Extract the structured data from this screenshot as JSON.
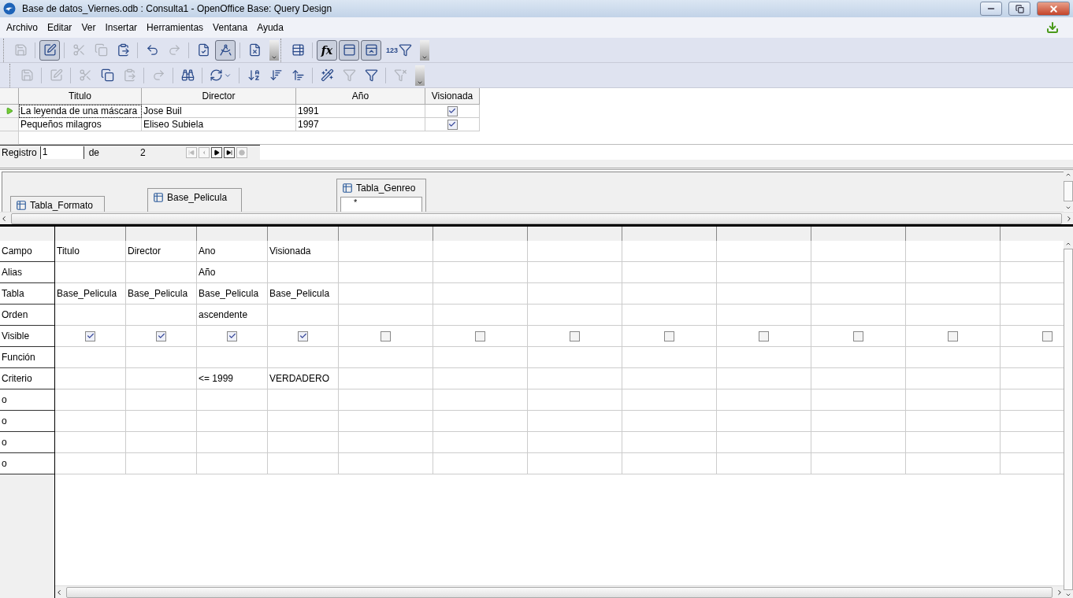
{
  "window": {
    "title": "Base de datos_Viernes.odb : Consulta1 - OpenOffice Base: Query Design"
  },
  "menu": [
    "Archivo",
    "Editar",
    "Ver",
    "Insertar",
    "Herramientas",
    "Ventana",
    "Ayuda"
  ],
  "toolbars": [
    {
      "buttons": [
        {
          "disabled": true,
          "pressed": false
        },
        {
          "disabled": false,
          "pressed": true
        },
        {
          "disabled": true,
          "pressed": false
        },
        {
          "disabled": true,
          "pressed": false
        },
        {
          "disabled": false,
          "pressed": false
        },
        {
          "disabled": false,
          "pressed": false
        },
        {
          "disabled": true,
          "pressed": false
        },
        {
          "disabled": false,
          "pressed": false
        },
        {
          "disabled": false,
          "pressed": true
        },
        {
          "disabled": false,
          "pressed": false
        }
      ]
    },
    {
      "buttons": [
        {
          "disabled": false,
          "pressed": false
        },
        {
          "disabled": false,
          "pressed": true,
          "label": "fx"
        },
        {
          "disabled": false,
          "pressed": true
        },
        {
          "disabled": false,
          "pressed": true
        },
        {
          "disabled": false,
          "pressed": false,
          "label": "123"
        }
      ]
    },
    {
      "buttons": [
        {
          "disabled": true,
          "pressed": false
        },
        {
          "disabled": true,
          "pressed": false
        },
        {
          "disabled": true,
          "pressed": false
        },
        {
          "disabled": false,
          "pressed": false
        },
        {
          "disabled": true,
          "pressed": false
        },
        {
          "disabled": true,
          "pressed": false
        },
        {
          "disabled": false,
          "pressed": false
        },
        {
          "disabled": false,
          "pressed": false
        },
        {
          "disabled": false,
          "pressed": false
        },
        {
          "disabled": false,
          "pressed": false
        },
        {
          "disabled": false,
          "pressed": false
        },
        {
          "disabled": false,
          "pressed": false
        },
        {
          "disabled": true,
          "pressed": false
        },
        {
          "disabled": false,
          "pressed": false
        },
        {
          "disabled": true,
          "pressed": false
        }
      ]
    }
  ],
  "results": {
    "columns": [
      "Titulo",
      "Director",
      "Año",
      "Visionada"
    ],
    "rows": [
      {
        "current": true,
        "cells": [
          "La leyenda de una máscara",
          "Jose Buil",
          "1991"
        ],
        "visionada": true
      },
      {
        "current": false,
        "cells": [
          "Pequeños milagros",
          "Eliseo Subiela",
          "1997"
        ],
        "visionada": true
      }
    ]
  },
  "navigator": {
    "label": "Registro",
    "value": "1",
    "of": "de",
    "total": "2",
    "buttons": [
      {
        "disabled": true
      },
      {
        "disabled": true
      },
      {
        "disabled": false
      },
      {
        "disabled": false
      },
      {
        "disabled": true
      }
    ]
  },
  "tables": [
    {
      "title": "Tabla_Formato"
    },
    {
      "title": "Base_Pelicula"
    },
    {
      "title": "Tabla_Genreo",
      "fields": [
        "*"
      ]
    }
  ],
  "design": {
    "row_labels": [
      "Campo",
      "Alias",
      "Tabla",
      "Orden",
      "Visible",
      "Función",
      "Criterio",
      "o",
      "o",
      "o",
      "o"
    ],
    "columns": [
      {
        "campo": "Titulo",
        "tabla": "Base_Pelicula",
        "visible": true
      },
      {
        "campo": "Director",
        "tabla": "Base_Pelicula",
        "visible": true
      },
      {
        "campo": "Ano",
        "alias": "Año",
        "tabla": "Base_Pelicula",
        "orden": "ascendente",
        "visible": true,
        "criterio": "<= 1999"
      },
      {
        "campo": "Visionada",
        "tabla": "Base_Pelicula",
        "visible": true,
        "criterio": "VERDADERO"
      },
      {
        "visible": false
      },
      {
        "visible": false
      },
      {
        "visible": false
      },
      {
        "visible": false
      },
      {
        "visible": false
      },
      {
        "visible": false
      },
      {
        "visible": false
      },
      {
        "visible": false
      }
    ]
  }
}
